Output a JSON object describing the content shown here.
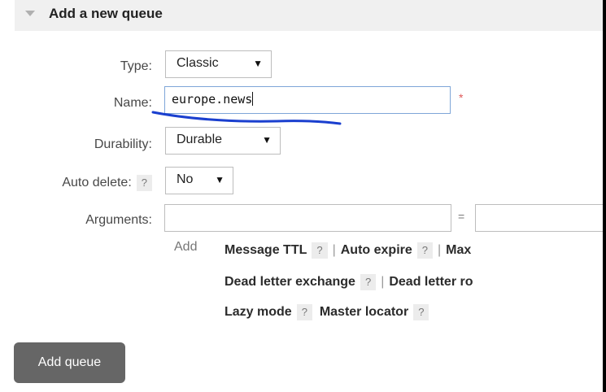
{
  "section": {
    "title": "Add a new queue"
  },
  "form": {
    "type": {
      "label": "Type:",
      "value": "Classic"
    },
    "name": {
      "label": "Name:",
      "value": "europe.news",
      "required_mark": "*"
    },
    "durability": {
      "label": "Durability:",
      "value": "Durable"
    },
    "auto_delete": {
      "label": "Auto delete:",
      "help": "?",
      "value": "No"
    },
    "arguments": {
      "label": "Arguments:",
      "key_value": "",
      "equals": "=",
      "value_value": "",
      "add_label": "Add",
      "presets": [
        {
          "label": "Message TTL",
          "help": "?"
        },
        {
          "label": "Auto expire",
          "help": "?"
        },
        {
          "label": "Max"
        },
        {
          "label": "Dead letter exchange",
          "help": "?"
        },
        {
          "label": "Dead letter ro"
        },
        {
          "label": "Lazy mode",
          "help": "?"
        },
        {
          "label": "Master locator",
          "help": "?"
        }
      ],
      "separator": "|"
    }
  },
  "submit": {
    "label": "Add queue"
  },
  "annotation": {
    "color": "#1a3fcf"
  }
}
